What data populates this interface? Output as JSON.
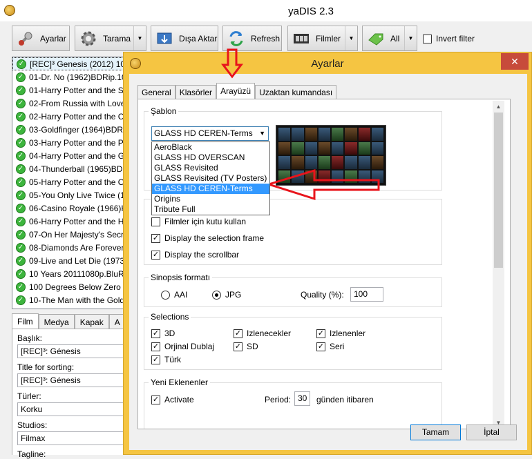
{
  "main": {
    "title": "yaDIS 2.3",
    "toolbar": {
      "settings": "Ayarlar",
      "scan": "Tarama",
      "export": "Dışa Aktar",
      "refresh": "Refresh",
      "movies": "Filmler",
      "all": "All",
      "invert_filter": "Invert filter"
    },
    "movies": [
      "[REC]³ Genesis (2012) 1080",
      "01-Dr. No (1962)BDRip.10",
      "01-Harry Potter and the S",
      "02-From Russia with Love",
      "02-Harry Potter and the C",
      "03-Goldfinger (1964)BDRi",
      "03-Harry Potter and the P",
      "04-Harry Potter and the G",
      "04-Thunderball (1965)BDI",
      "05-Harry Potter and the O",
      "05-You Only Live Twice (1",
      "06-Casino Royale (1966)H",
      "06-Harry Potter and the H",
      "07-On Her Majesty's Secr",
      "08-Diamonds Are Forever",
      "09-Live and Let Die (1973)",
      "10 Years 20111080p.BluRa",
      "100 Degrees Below Zero (",
      "10-The Man with the Gold"
    ],
    "detail_tabs": [
      "Film",
      "Medya",
      "Kapak",
      "A"
    ],
    "fields": {
      "title_label": "Başlık:",
      "title_value": "[REC]³: Génesis",
      "sort_label": "Title for sorting:",
      "sort_value": "[REC]³: Génesis",
      "genres_label": "Türler:",
      "genres_value": "Korku",
      "studios_label": "Studios:",
      "studios_value": "Filmax",
      "tagline_label": "Tagline:"
    }
  },
  "dialog": {
    "title": "Ayarlar",
    "close": "✕",
    "tabs": [
      "General",
      "Klasörler",
      "Arayüzü",
      "Uzaktan kumandası"
    ],
    "template_group": "Şablon",
    "template_selected": "GLASS HD CEREN-Terms",
    "template_options": [
      "AeroBlack",
      "GLASS HD OVERSCAN",
      "GLASS Revisited",
      "GLASS Revisited (TV Posters)",
      "GLASS HD CEREN-Terms",
      "Origins",
      "Tribute Full"
    ],
    "options": {
      "use_box": "Filmler için kutu kullan",
      "selection_frame": "Display the selection frame",
      "scrollbar": "Display the scrollbar"
    },
    "synopsis": {
      "label": "Sinopsis formatı",
      "aai": "AAI",
      "jpg": "JPG",
      "quality_label": "Quality (%):",
      "quality_value": "100"
    },
    "selections": {
      "label": "Selections",
      "items": [
        "3D",
        "Izlenecekler",
        "Izlenenler",
        "Orjinal Dublaj",
        "SD",
        "Seri",
        "Türk"
      ]
    },
    "new_added": {
      "label": "Yeni Eklenenler",
      "activate": "Activate",
      "period_label": "Period:",
      "period_value": "30",
      "period_suffix": "günden itibaren"
    },
    "ok": "Tamam",
    "cancel": "İptal"
  },
  "colors": {
    "dialog_frame": "#f5c542",
    "close": "#c74b3b",
    "highlight": "#3399ff",
    "annotation": "#e8141b"
  }
}
